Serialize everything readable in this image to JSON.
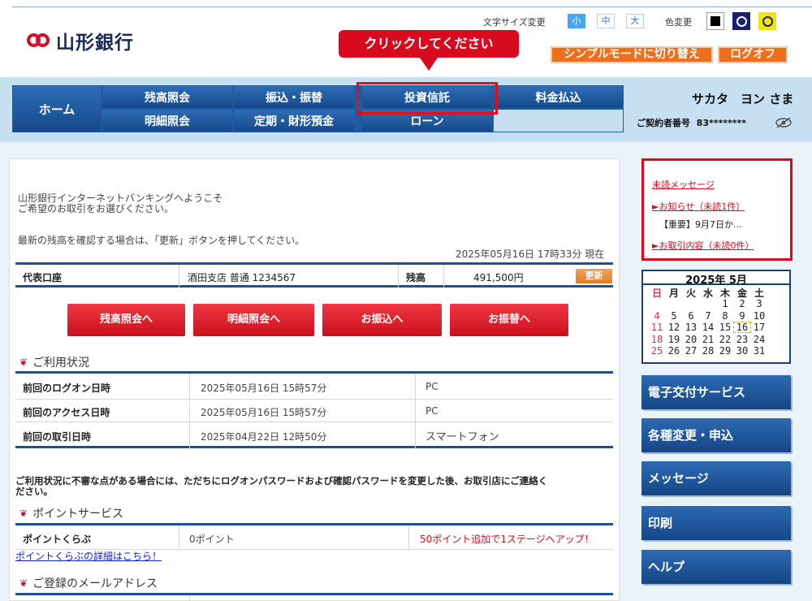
{
  "header": {
    "logo_text": "山形銀行",
    "font_size_label": "文字サイズ変更",
    "font_size_options": [
      "小",
      "中",
      "大"
    ],
    "color_label": "色変更",
    "tooltip": "クリックしてください",
    "simple_mode_button": "シンプルモードに切り替え",
    "logoff_button": "ログオフ"
  },
  "nav": {
    "home": "ホーム",
    "row1": [
      "残高照会",
      "振込・振替",
      "投資信託",
      "料金払込"
    ],
    "row2": [
      "明細照会",
      "定期・財形預金",
      "ローン"
    ],
    "user_name": "サカタ　ヨン さま",
    "contract_label": "ご契約者番号",
    "contract_number": "83********"
  },
  "main": {
    "welcome_line1": "山形銀行インターネットバンキングへようこそ",
    "welcome_line2": "ご希望のお取引をお選びください。",
    "update_hint": "最新の残高を確認する場合は、「更新」ボタンを押してください。",
    "timestamp": "2025年05月16日 17時33分 現在",
    "account": {
      "label": "代表口座",
      "value": "酒田支店 普通 1234567",
      "balance_label": "残高",
      "balance": "491,500円",
      "update_button": "更新"
    },
    "buttons": [
      "残高照会へ",
      "明細照会へ",
      "お振込へ",
      "お振替へ"
    ],
    "usage": {
      "title": "ご利用状況",
      "rows": [
        {
          "label": "前回のログオン日時",
          "date": "2025年05月16日 15時57分",
          "device": "PC"
        },
        {
          "label": "前回のアクセス日時",
          "date": "2025年05月16日 15時57分",
          "device": "PC"
        },
        {
          "label": "前回の取引日時",
          "date": "2025年04月22日 12時50分",
          "device": "スマートフォン"
        }
      ]
    },
    "warning_line1": "ご利用状況に不審な点がある場合には、ただちにログオンパスワードおよび確認パスワードを変更した後、お取引店にご連絡く",
    "warning_line2": "ださい。",
    "points": {
      "title": "ポイントサービス",
      "label": "ポイントくらぶ",
      "value": "0ポイント",
      "promo": "50ポイント追加で1ステージへアップ！",
      "link": "ポイントくらぶの詳細はこちら！"
    },
    "email_title": "ご登録のメールアドレス"
  },
  "messages": {
    "title": "未読メッセージ",
    "notice_link": "►お知らせ（未読1件）",
    "notice_item": "【重要】9月7日か...",
    "transaction_link": "►お取引内容（未読0件）"
  },
  "calendar": {
    "title": "2025年 5月",
    "weekdays": [
      "日",
      "月",
      "火",
      "水",
      "木",
      "金",
      "土"
    ],
    "weeks": [
      [
        "",
        "",
        "",
        "",
        "1",
        "2",
        "3"
      ],
      [
        "4",
        "5",
        "6",
        "7",
        "8",
        "9",
        "10"
      ],
      [
        "11",
        "12",
        "13",
        "14",
        "15",
        "16",
        "17"
      ],
      [
        "18",
        "19",
        "20",
        "21",
        "22",
        "23",
        "24"
      ],
      [
        "25",
        "26",
        "27",
        "28",
        "29",
        "30",
        "31"
      ]
    ],
    "today": "16",
    "colors": {
      "sunday": "#e0305a",
      "weekday": "#222222",
      "header": "#1b3d78",
      "today_border": "#e8a317"
    }
  },
  "side_menu": [
    "電子交付サービス",
    "各種変更・申込",
    "メッセージ",
    "印刷",
    "ヘルプ"
  ]
}
